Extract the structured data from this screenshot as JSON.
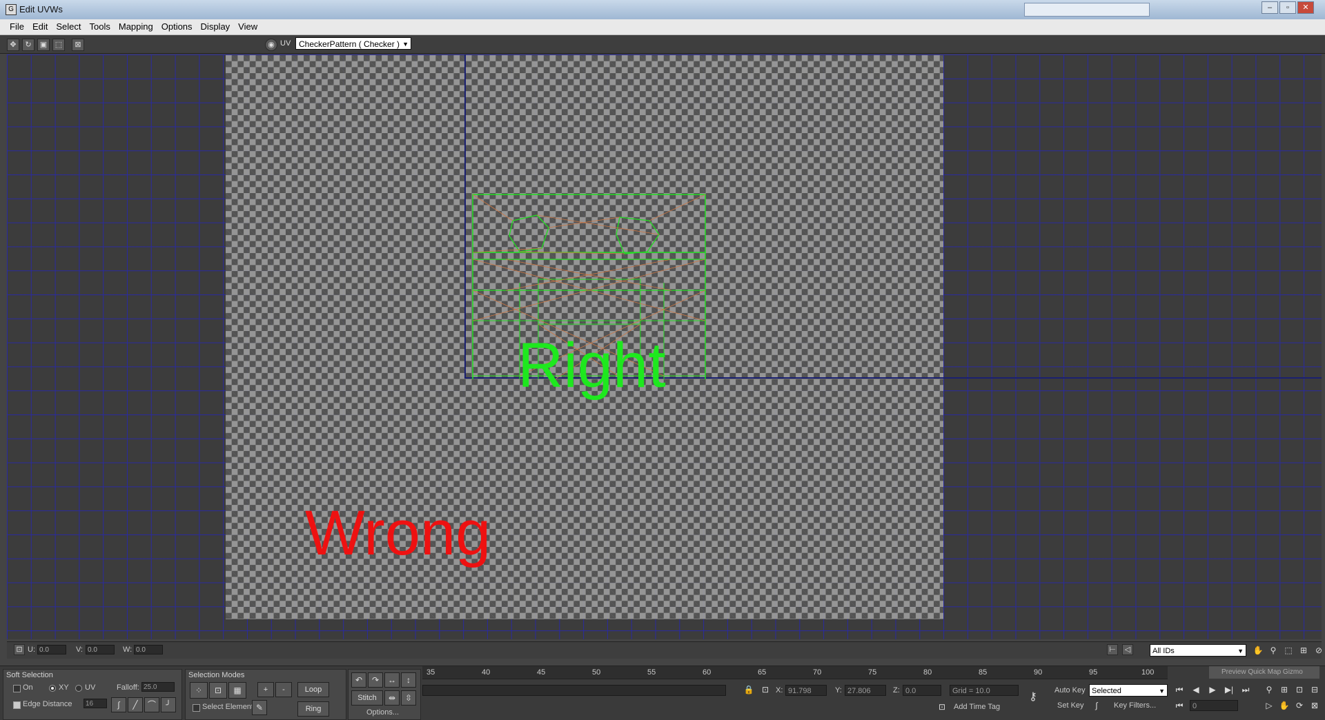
{
  "window": {
    "title": "Edit UVWs",
    "app_icon": "3dsmax-icon",
    "controls": [
      "minimize-icon",
      "maximize-icon",
      "close-icon"
    ]
  },
  "menubar": [
    "File",
    "Edit",
    "Select",
    "Tools",
    "Mapping",
    "Options",
    "Display",
    "View"
  ],
  "toolbar": {
    "icons": [
      "move-icon",
      "rotate-icon",
      "scale-icon",
      "freeform-icon",
      "mirror-icon"
    ],
    "map_icon": "checker-map-icon",
    "uv_label": "UV",
    "map_select": "CheckerPattern  ( Checker )"
  },
  "viewport": {
    "label_right": "Right",
    "label_wrong": "Wrong",
    "colors": {
      "right": "#1ee81e",
      "wrong": "#ee1111",
      "grid": "#2828aa",
      "uv_edges": "#22dd22"
    }
  },
  "coord_bar": {
    "u_label": "U:",
    "u_value": "0.0",
    "v_label": "V:",
    "v_value": "0.0",
    "w_label": "W:",
    "w_value": "0.0",
    "ids_select": "All IDs"
  },
  "soft_selection": {
    "title": "Soft Selection",
    "on_label": "On",
    "xy_label": "XY",
    "uv_label": "UV",
    "falloff_label": "Falloff:",
    "falloff_value": "25.0",
    "edge_distance_label": "Edge Distance",
    "edge_distance_value": "16"
  },
  "selection_modes": {
    "title": "Selection Modes",
    "select_element_label": "Select Element",
    "plus": "+",
    "minus": "-",
    "loop_label": "Loop",
    "ring_label": "Ring"
  },
  "stitch": {
    "stitch_label": "Stitch",
    "options_label": "Options..."
  },
  "timeline": {
    "ticks": [
      "35",
      "40",
      "45",
      "50",
      "55",
      "60",
      "65",
      "70",
      "75",
      "80",
      "85",
      "90",
      "95",
      "100"
    ],
    "preview_label": "Preview Quick Map Gizmo"
  },
  "status": {
    "x_label": "X:",
    "x_value": "91.798",
    "y_label": "Y:",
    "y_value": "27.806",
    "z_label": "Z:",
    "z_value": "0.0",
    "grid_text": "Grid = 10.0",
    "add_time_tag": "Add Time Tag",
    "auto_key": "Auto Key",
    "selected_select": "Selected",
    "set_key": "Set Key",
    "key_filters": "Key Filters...",
    "frame_value": "0"
  }
}
